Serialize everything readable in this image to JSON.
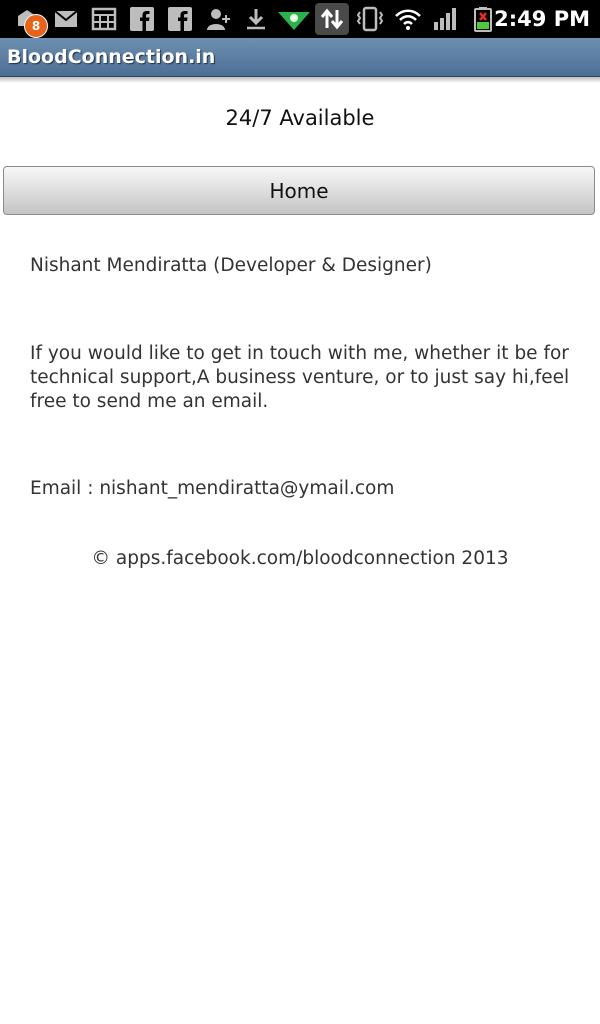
{
  "status_bar": {
    "notification_count": "8",
    "time": "2:49 PM",
    "icons": [
      "app-notification-icon",
      "gmail-icon",
      "calendar-icon",
      "facebook-icon",
      "facebook-icon",
      "add-contact-icon",
      "download-icon",
      "android-market-icon",
      "data-transfer-icon",
      "vibrate-icon",
      "wifi-icon",
      "signal-icon",
      "battery-icon"
    ]
  },
  "app": {
    "title": "BloodConnection.in"
  },
  "header": {
    "availability": "24/7 Available"
  },
  "nav": {
    "home_label": "Home"
  },
  "content": {
    "developer": "Nishant Mendiratta (Developer & Designer)",
    "message": "If you would like to get in touch with me, whether it be for technical support,A business venture, or to just say hi,feel free to send me an email.",
    "email": "Email : nishant_mendiratta@ymail.com"
  },
  "footer": {
    "copyright": "© apps.facebook.com/bloodconnection 2013"
  },
  "colors": {
    "title_bar": "#5b7ea3",
    "status_bar": "#000000",
    "badge": "#e8631a",
    "text": "#333333"
  }
}
